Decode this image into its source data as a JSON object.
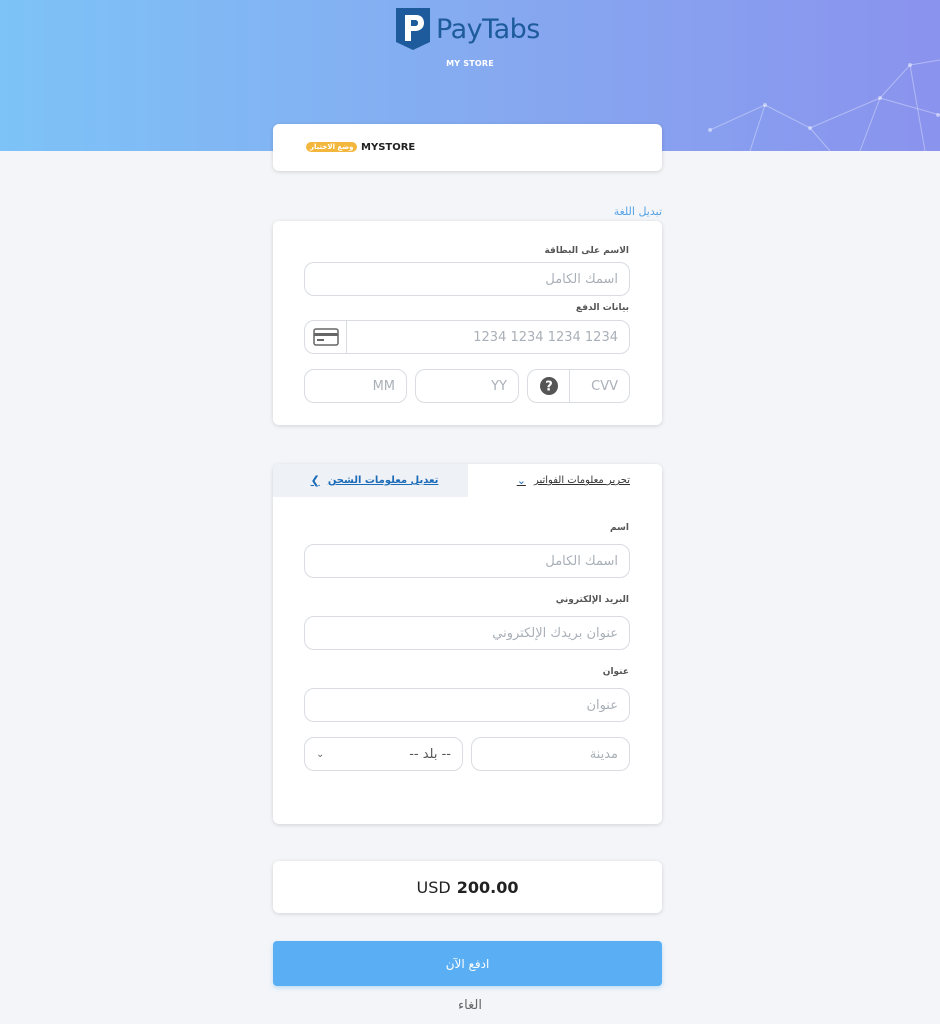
{
  "header": {
    "logo_text": "PayTabs",
    "store_name": "MY STORE"
  },
  "merchant": {
    "name": "MYSTORE",
    "badge": "وضع الاختبار"
  },
  "language_link": "تبديل اللغة",
  "card_form": {
    "name_label": "الاسم على البطاقة",
    "name_placeholder": "اسمك الكامل",
    "payment_label": "بيانات الدفع",
    "card_number_placeholder": "1234 1234 1234 1234",
    "month_placeholder": "MM",
    "year_placeholder": "YY",
    "cvv_placeholder": "CVV"
  },
  "tabs": {
    "billing": "تحرير معلومات الفواتير",
    "shipping": "تعديل معلومات الشحن"
  },
  "billing_form": {
    "name_label": "اسم",
    "name_placeholder": "اسمك الكامل",
    "email_label": "البريد الإلكتروني",
    "email_placeholder": "عنوان بريدك الإلكتروني",
    "address_label": "عنوان",
    "address_placeholder": "عنوان",
    "city_placeholder": "مدينة",
    "country_select": "-- بلد --"
  },
  "amount": {
    "currency": "USD",
    "value": "200.00"
  },
  "actions": {
    "pay": "ادفع الآن",
    "cancel": "الغاء"
  },
  "colors": {
    "accent": "#5aaef3",
    "badge": "#f4b73d",
    "logo": "#1d5b9c"
  }
}
